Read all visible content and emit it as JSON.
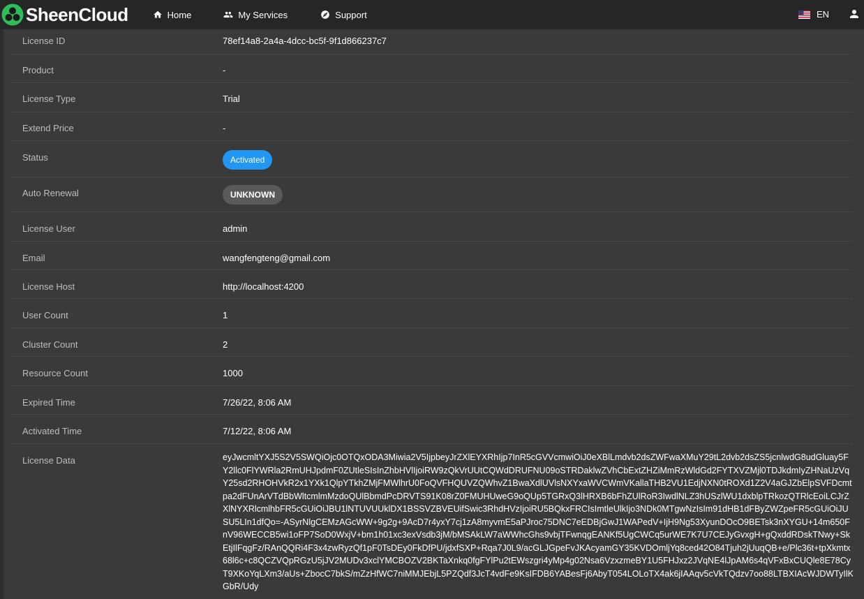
{
  "brand": {
    "name": "SheenCloud",
    "logo_color": "#2ebd59"
  },
  "nav": {
    "home": {
      "label": "Home",
      "icon": "home-icon"
    },
    "services": {
      "label": "My Services",
      "icon": "people-icon"
    },
    "support": {
      "label": "Support",
      "icon": "compass-icon"
    }
  },
  "language": {
    "label": "EN",
    "icon": "us-flag-icon"
  },
  "user_icon": "account-icon",
  "colors": {
    "activated": "#2196f3",
    "unknown": "#5a5a5a",
    "background": "#3a3a3a",
    "topbar": "#262626"
  },
  "details": {
    "license_id": {
      "label": "License ID",
      "value": "78ef14a8-2a4a-4dcc-bc5f-9f1d866237c7"
    },
    "product": {
      "label": "Product",
      "value": "-"
    },
    "license_type": {
      "label": "License Type",
      "value": "Trial"
    },
    "extend_price": {
      "label": "Extend Price",
      "value": "-"
    },
    "status": {
      "label": "Status",
      "value": "Activated"
    },
    "auto_renewal": {
      "label": "Auto Renewal",
      "value": "UNKNOWN"
    },
    "license_user": {
      "label": "License User",
      "value": "admin"
    },
    "email": {
      "label": "Email",
      "value": "wangfengteng@gmail.com"
    },
    "license_host": {
      "label": "License Host",
      "value": "http://localhost:4200"
    },
    "user_count": {
      "label": "User Count",
      "value": "1"
    },
    "cluster_count": {
      "label": "Cluster Count",
      "value": "2"
    },
    "resource_count": {
      "label": "Resource Count",
      "value": "1000"
    },
    "expired_time": {
      "label": "Expired Time",
      "value": "7/26/22, 8:06 AM"
    },
    "activated_time": {
      "label": "Activated Time",
      "value": "7/12/22, 8:06 AM"
    },
    "license_data": {
      "label": "License Data",
      "value": "eyJwcmltYXJ5S2V5SWQiOjc0OTQxODA3Miwia2V5IjpbeyJrZXlEYXRhIjp7InR5cGVVcmwiOiJ0eXBlLmdvb2dsZWFwaXMuY29tL2dvb2dsZS5jcnlwdG8udGluay5FY2llc0FlYWRla2RmUHJpdmF0ZUtleSIsInZhbHVlIjoiRW9zQkVrUUtCQWdDRUFNU09oSTRDaklwZVhCbExtZHZiMmRzWldGd2FYTXVZMjl0TDJkdmIyZHNaUzVqY25sd2RHOHVkR2x1YXk1QlpYTkhZMjFMWlhrU0FoQVFHQUVZQWhvZ1BwaXdlUVlsNXYxaWVCWmVKallaTHB2VU1EdjNXN0tROXd1Z2V4aGJZbElpSVFDcmtpa2dFUnArVTdBbWltcmlmMzdoQUlBbmdPcDRVTS91K08rZ0FMUHUweG9oQUp5TGRxQ3lHRXB6bFhZUlRoR3IwdlNLZ3hUSzlWU1dxblpTRkozQTRlcEoiLCJrZXlNYXRlcmlhbFR5cGUiOiJBU1lNTUVUUklDX1BSSVZBVEUifSwic3RhdHVzIjoiRU5BQkxFRCIsImtleUlkIjo3NDk0MTgwNzIsIm91dHB1dFByZWZpeFR5cGUiOiJUSU5LIn1dfQo=-ASyrNlgCEMzAGcWW+9g2g+9AcD7r4yxY7cj1zA8myvmE5aPJroc75DNC7eEDBjGwJ1WAPedV+IjH9Ng53XyunDOcO9BETsk3nXYGU+14m650FnV96WECCB5wi1oFP7SoD0WxjV+bm1h01xc3exVsdb3jM/bMSAkLW7aWWhcGhs9vbjTFwnqgEANKf5UgCWCq5urWE7K7U7CEJyGvxgH+gQxddRDskTNwy+SkEtjIlFqgFz/RAnQQRi4F3x4zwRyzQf1pF0TsDEy0FkDfPU/jdxfSXP+Rqa7J0L9/acGLJGpeFvJKAcyamGY35KVDOmljYq8ced42O84Tjuh2jUuqQB+e/Plc36t+tpXkmtx68l6c+c8QCZVQpRGzU5jJV2MUDv3xclYMCBOZV2BKTaXnkq0fgFYlPu2tEWszgri4yMp4g02Nsa6VzxzmeBY1U5FHJxz2JVqNE4lJpAM6s4qVFxBxCUQle8E78CyT9XKoYqLXm3/aUs+ZbocC7bkS/mZzHfWC7niMMJEbjL5PZQdf3JcT4vdFe9KsIFDB6YABesFj6AbyT054LOLoTX4ak6jIAAqv5cVkTQdzv7oo88LTBXIAcWJDWTyIlKGbR/Udy"
    }
  }
}
